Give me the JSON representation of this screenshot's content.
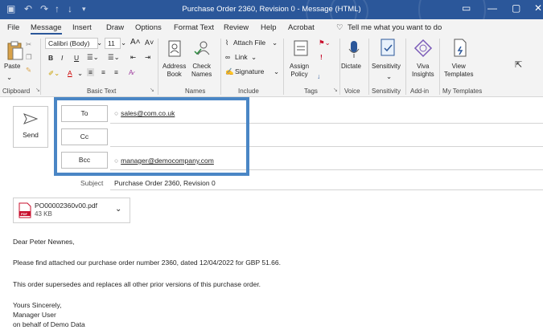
{
  "window": {
    "title": "Purchase Order 2360, Revision 0  -  Message (HTML)"
  },
  "menu": {
    "items": [
      "File",
      "Message",
      "Insert",
      "Draw",
      "Options",
      "Format Text",
      "Review",
      "Help",
      "Acrobat"
    ],
    "tell_me": "Tell me what you want to do"
  },
  "ribbon": {
    "paste": "Paste",
    "font_name": "Calibri (Body)",
    "font_size": "11",
    "address_book": [
      "Address",
      "Book"
    ],
    "check_names": [
      "Check",
      "Names"
    ],
    "attach_file": "Attach File",
    "link": "Link",
    "signature": "Signature",
    "assign_policy": [
      "Assign",
      "Policy"
    ],
    "dictate": "Dictate",
    "sensitivity": "Sensitivity",
    "viva_insights": [
      "Viva",
      "Insights"
    ],
    "view_templates": [
      "View",
      "Templates"
    ],
    "groups": [
      "Clipboard",
      "Basic Text",
      "Names",
      "Include",
      "Tags",
      "Voice",
      "Sensitivity",
      "Add-in",
      "My Templates"
    ]
  },
  "compose": {
    "send": "Send",
    "to_label": "To",
    "cc_label": "Cc",
    "bcc_label": "Bcc",
    "to_value": "sales@com.co.uk",
    "bcc_value": "manager@democompany.com",
    "subject_label": "Subject",
    "subject_value": "Purchase Order 2360, Revision 0"
  },
  "attachment": {
    "filename": "PO00002360v00.pdf",
    "size": "43 KB",
    "type_badge": "PDF"
  },
  "body": {
    "greeting": "Dear Peter Newnes,",
    "line1": "Please find attached our purchase order number 2360, dated 12/04/2022 for GBP 51.66.",
    "line2": "This order supersedes and replaces all other prior versions of this purchase order.",
    "closing": "Yours Sincerely,",
    "sender": "Manager User",
    "on_behalf": "on behalf of Demo Data"
  },
  "colors": {
    "title_bar": "#2b579a",
    "highlight_border": "#4a86c5",
    "pdf_red": "#c8102e"
  }
}
